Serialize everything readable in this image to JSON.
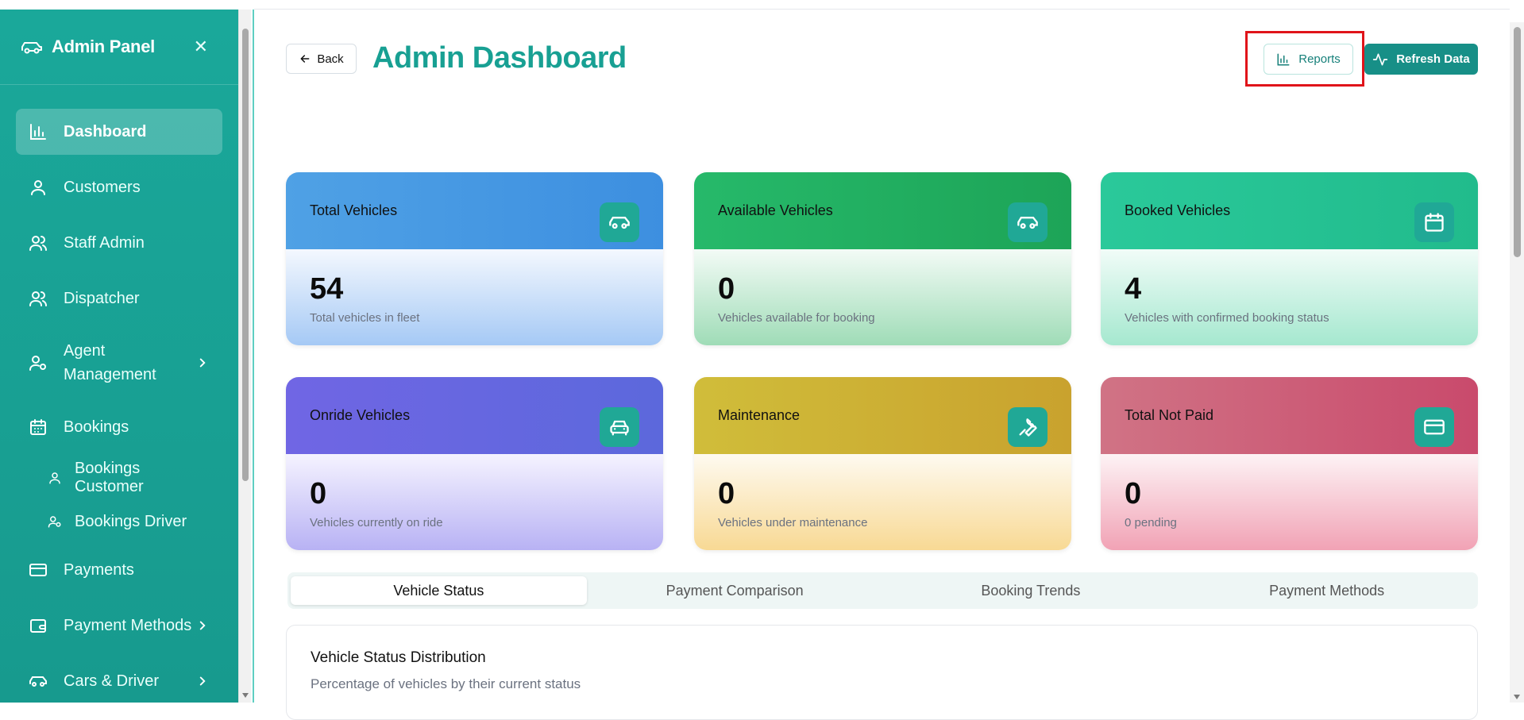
{
  "sidebar": {
    "title": "Admin Panel",
    "close_label": "✕",
    "items": [
      {
        "label": "Dashboard",
        "icon": "bar-chart-icon",
        "active": true
      },
      {
        "label": "Customers",
        "icon": "user-icon"
      },
      {
        "label": "Staff Admin",
        "icon": "users-icon"
      },
      {
        "label": "Dispatcher",
        "icon": "users-icon"
      },
      {
        "label": "Agent",
        "label2": "Management",
        "icon": "user-cog-icon",
        "expandable": true
      },
      {
        "label": "Bookings",
        "icon": "calendar-icon"
      },
      {
        "label": "Bookings Customer",
        "icon": "user-icon",
        "sub": true
      },
      {
        "label": "Bookings Driver",
        "icon": "user-cog-icon",
        "sub": true
      },
      {
        "label": "Payments",
        "icon": "credit-card-icon"
      },
      {
        "label": "Payment Methods",
        "icon": "wallet-icon",
        "expandable": true
      },
      {
        "label": "Cars & Driver",
        "icon": "car-icon",
        "expandable": true
      }
    ]
  },
  "header": {
    "back_label": "Back",
    "title": "Admin Dashboard",
    "reports_label": "Reports",
    "refresh_label": "Refresh Data"
  },
  "cards": [
    {
      "title": "Total Vehicles",
      "value": "54",
      "desc": "Total vehicles in fleet",
      "icon": "car-icon"
    },
    {
      "title": "Available Vehicles",
      "value": "0",
      "desc": "Vehicles available for booking",
      "icon": "car-icon"
    },
    {
      "title": "Booked Vehicles",
      "value": "4",
      "desc": "Vehicles with confirmed booking status",
      "icon": "calendar-icon"
    },
    {
      "title": "Onride Vehicles",
      "value": "0",
      "desc": "Vehicles currently on ride",
      "icon": "car-front-icon"
    },
    {
      "title": "Maintenance",
      "value": "0",
      "desc": "Vehicles under maintenance",
      "icon": "wrench-icon"
    },
    {
      "title": "Total Not Paid",
      "value": "0",
      "desc": "0 pending",
      "icon": "credit-card-icon"
    }
  ],
  "tabs": [
    {
      "label": "Vehicle Status",
      "active": true
    },
    {
      "label": "Payment Comparison"
    },
    {
      "label": "Booking Trends"
    },
    {
      "label": "Payment Methods"
    }
  ],
  "panel": {
    "title": "Vehicle Status Distribution",
    "subtitle": "Percentage of vehicles by their current status"
  },
  "colors": {
    "sidebar": "#1aa89a",
    "accent": "#18a093",
    "highlight": "#e0141a"
  }
}
